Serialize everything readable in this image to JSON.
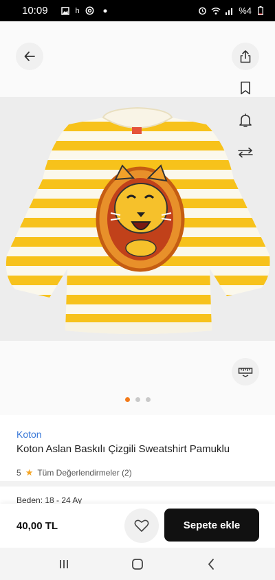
{
  "status_bar": {
    "time": "10:09",
    "carrier_glyph": "h",
    "battery_text": "%4",
    "left_icons": [
      "image-icon",
      "at-sign-icon",
      "dot-icon"
    ],
    "right_icons": [
      "alarm-icon",
      "wifi-icon",
      "signal-icon",
      "battery-icon"
    ]
  },
  "product": {
    "brand": "Koton",
    "title": "Koton Aslan Baskılı Çizgili Sweatshirt Pamuklu",
    "rating": "5",
    "reviews_label": "Tüm Değerlendirmeler (2)",
    "size_label": "Beden: 18 - 24 Ay",
    "image_count": 3,
    "active_image": 1
  },
  "buy_bar": {
    "price": "40,00 TL",
    "add_to_cart_label": "Sepete ekle"
  },
  "icons": {
    "back": "back-arrow-icon",
    "share": "share-icon",
    "bookmark": "bookmark-icon",
    "alert": "bell-icon",
    "compare": "compare-arrows-icon",
    "size_guide": "ruler-icon",
    "favorite": "heart-icon"
  },
  "colors": {
    "accent": "#f27a1a",
    "brand_link": "#3c7ad8",
    "stripe_yellow": "#f7c21b",
    "button_dark": "#111111"
  }
}
